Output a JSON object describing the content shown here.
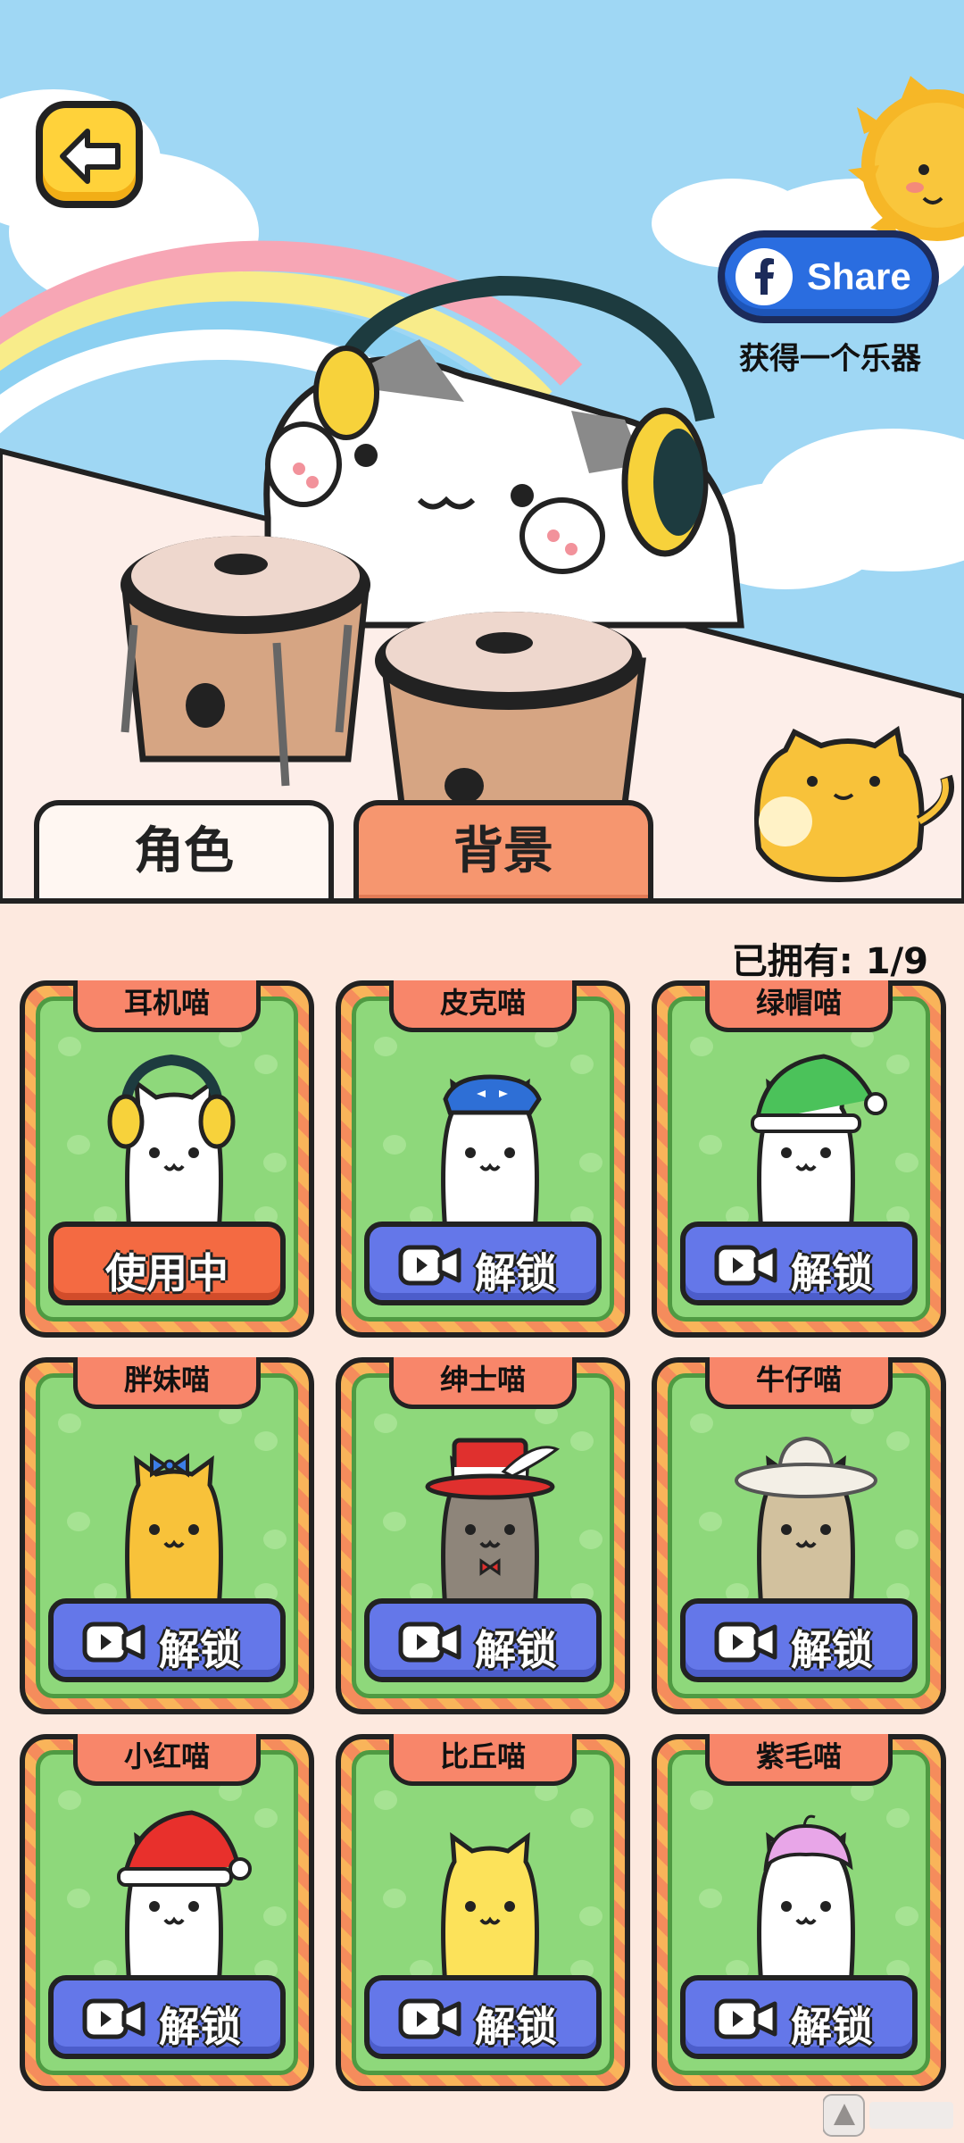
{
  "header": {
    "share_label": "Share",
    "share_sub": "获得一个乐器"
  },
  "tabs": [
    {
      "label": "角色",
      "active": true
    },
    {
      "label": "背景",
      "active": false
    }
  ],
  "owned_text": "已拥有: 1/9",
  "cards": [
    {
      "name": "耳机喵",
      "button": "使用中",
      "state": "in-use",
      "hat": "headphones",
      "fur": "#ffffff"
    },
    {
      "name": "皮克喵",
      "button": "解锁",
      "state": "locked",
      "hat": "blue-bandana",
      "fur": "#ffffff"
    },
    {
      "name": "绿帽喵",
      "button": "解锁",
      "state": "locked",
      "hat": "green-beanie",
      "fur": "#ffffff"
    },
    {
      "name": "胖妹喵",
      "button": "解锁",
      "state": "locked",
      "hat": "blue-bow",
      "fur": "#f8c23a"
    },
    {
      "name": "绅士喵",
      "button": "解锁",
      "state": "locked",
      "hat": "red-top-hat",
      "fur": "#8e857a"
    },
    {
      "name": "牛仔喵",
      "button": "解锁",
      "state": "locked",
      "hat": "cowboy-hat",
      "fur": "#d2c19e"
    },
    {
      "name": "小红喵",
      "button": "解锁",
      "state": "locked",
      "hat": "santa-hat",
      "fur": "#ffffff"
    },
    {
      "name": "比丘喵",
      "button": "解锁",
      "state": "locked",
      "hat": "none",
      "fur": "#fce25a"
    },
    {
      "name": "紫毛喵",
      "button": "解锁",
      "state": "locked",
      "hat": "purple-hair",
      "fur": "#ffffff"
    }
  ],
  "colors": {
    "sky": "#9fd7f4",
    "in_use": "#f46a42",
    "unlock": "#6477e9",
    "card_green": "#8ed87b"
  }
}
